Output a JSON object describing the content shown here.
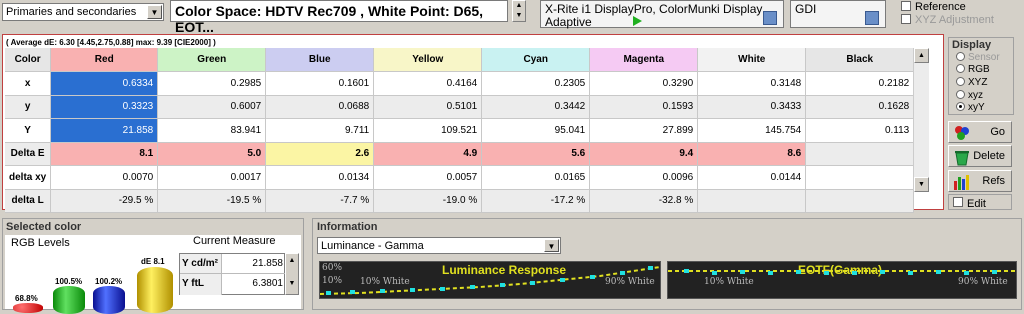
{
  "toolbar": {
    "primaries_select": "Primaries and secondaries",
    "colorspace_label": "Color Space: HDTV Rec709 , White Point: D65, EOT...",
    "probe_name": "X-Rite i1 DisplayPro, ColorMunki Display",
    "probe_mode": "Adaptive",
    "generator": "GDI",
    "reference_label": "Reference",
    "xyz_adjust_label": "XYZ Adjustment"
  },
  "summary": "( Average dE: 6.30 [4.45,2.75,0.88] max: 9.39 [CIE2000] )",
  "grid": {
    "headers": [
      "Color",
      "Red",
      "Green",
      "Blue",
      "Yellow",
      "Cyan",
      "Magenta",
      "White",
      "Black"
    ],
    "header_colors": [
      "#e6e6e6",
      "#f9b1b1",
      "#cdf3c6",
      "#cccdf1",
      "#f8f6c8",
      "#c9f2f2",
      "#f5caf3",
      "#f2f2f2",
      "#e6e6e6"
    ],
    "rows": [
      {
        "label": "x",
        "cells": [
          "0.6334",
          "0.2985",
          "0.1601",
          "0.4164",
          "0.2305",
          "0.3290",
          "0.3148",
          "0.2182"
        ]
      },
      {
        "label": "y",
        "cells": [
          "0.3323",
          "0.6007",
          "0.0688",
          "0.5101",
          "0.3442",
          "0.1593",
          "0.3433",
          "0.1628"
        ]
      },
      {
        "label": "Y",
        "cells": [
          "21.858",
          "83.941",
          "9.711",
          "109.521",
          "95.041",
          "27.899",
          "145.754",
          "0.113"
        ]
      },
      {
        "label": "Delta E",
        "cells": [
          "8.1",
          "5.0",
          "2.6",
          "4.9",
          "5.6",
          "9.4",
          "8.6",
          ""
        ]
      },
      {
        "label": "delta xy",
        "cells": [
          "0.0070",
          "0.0017",
          "0.0134",
          "0.0057",
          "0.0165",
          "0.0096",
          "0.0144",
          ""
        ]
      },
      {
        "label": "delta L",
        "cells": [
          "-29.5 %",
          "-19.5 %",
          "-7.7 %",
          "-19.0 %",
          "-17.2 %",
          "-32.8 %",
          "",
          ""
        ]
      }
    ]
  },
  "display_panel": {
    "title": "Display",
    "options": [
      "Sensor",
      "RGB",
      "XYZ",
      "xyz",
      "xyY"
    ],
    "selected": "xyY"
  },
  "buttons": {
    "go": "Go",
    "delete": "Delete",
    "refs": "Refs",
    "edit": "Edit"
  },
  "selected_color": {
    "title": "Selected color",
    "rgb_levels": "RGB Levels",
    "current_measure": "Current Measure",
    "bars": [
      {
        "label": "68.8%",
        "color": "#d01010",
        "value": 0.688
      },
      {
        "label": "100.5%",
        "color": "#10b010",
        "value": 1.005
      },
      {
        "label": "100.2%",
        "color": "#1020d0",
        "value": 1.002
      },
      {
        "label": "dE 8.1",
        "color": "#f0d000",
        "value": 0.81
      }
    ],
    "measures": [
      {
        "label": "Y cd/m²",
        "value": "21.858"
      },
      {
        "label": "Y ftL",
        "value": "6.3801"
      }
    ]
  },
  "information": {
    "title": "Information",
    "select": "Luminance - Gamma",
    "chart1_title": "Luminance Response",
    "chart1_labels": [
      "60%",
      "10%",
      "10% White",
      "90% White"
    ],
    "chart2_title": "EOTF(Gamma)",
    "chart2_labels": [
      "10% White",
      "90% White"
    ]
  }
}
